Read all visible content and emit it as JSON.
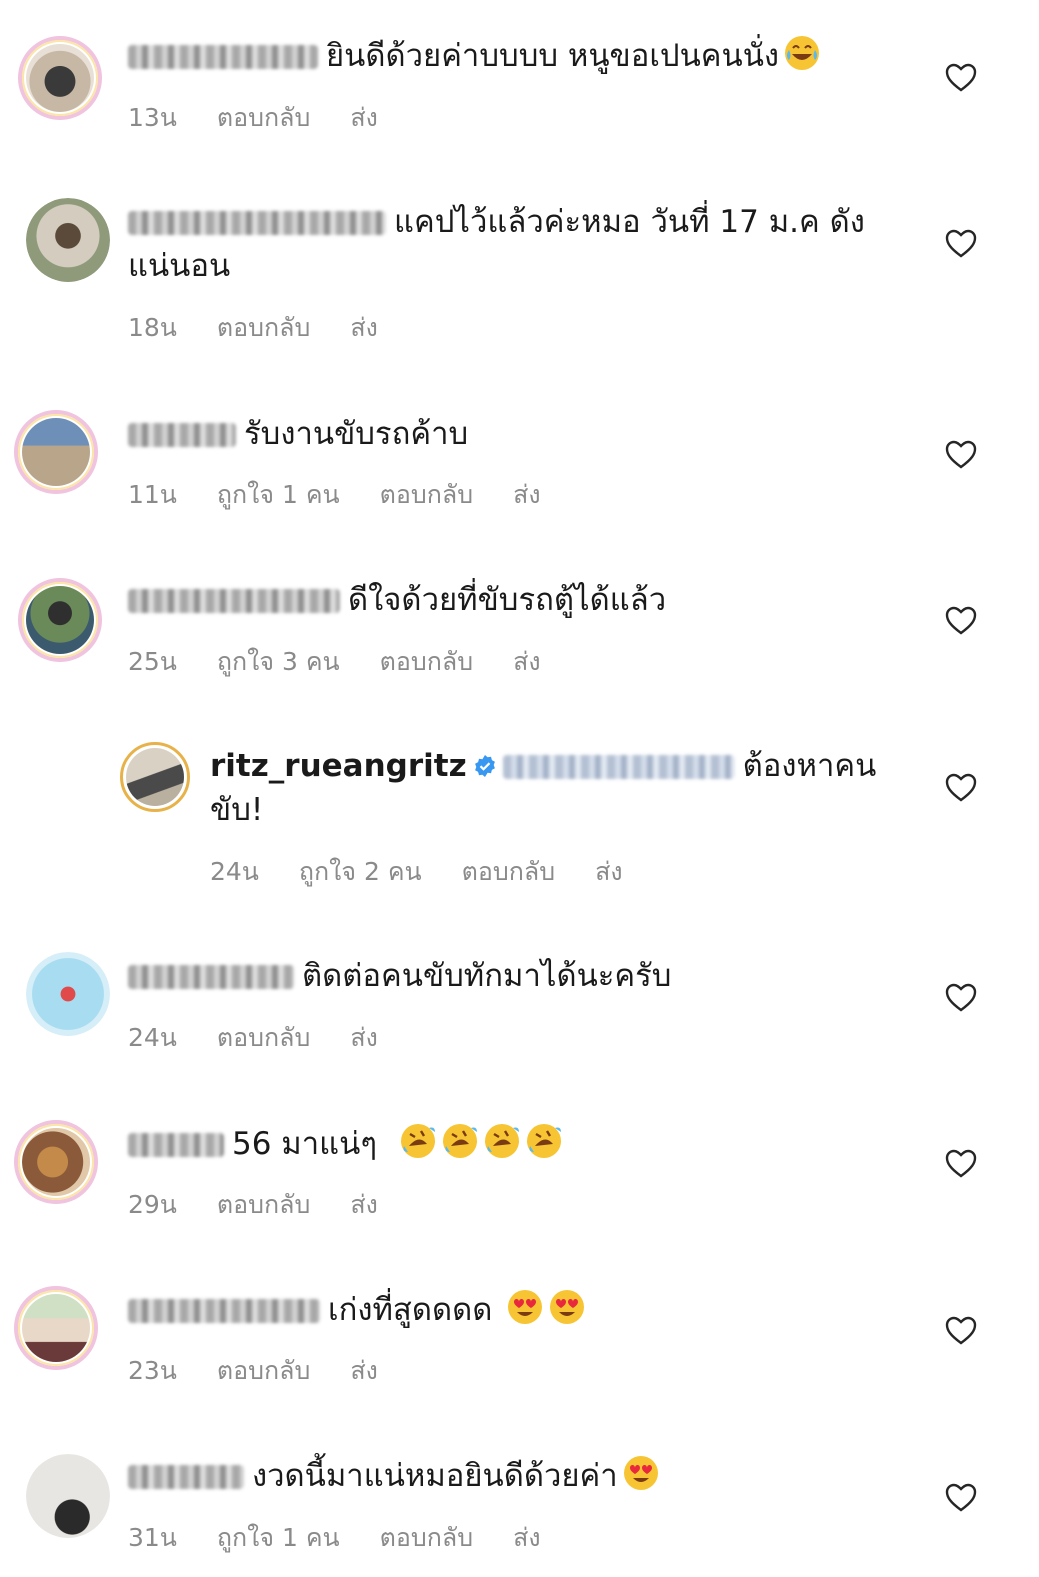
{
  "comments": [
    {
      "text": "ยินดีด้วยค่าบบบบ หนูขอเปนคนนั่ง",
      "emoji": [
        "laugh-tears"
      ],
      "time": "13น",
      "likes": "",
      "reply": "ตอบกลับ",
      "send": "ส่ง"
    },
    {
      "text": "แคปไว้แล้วค่ะหมอ วันที่ 17 ม.ค ดัง",
      "text2": "แน่นอน",
      "time": "18น",
      "likes": "",
      "reply": "ตอบกลับ",
      "send": "ส่ง"
    },
    {
      "text": "รับงานขับรถค้าบ",
      "time": "11น",
      "likes": "ถูกใจ 1 คน",
      "reply": "ตอบกลับ",
      "send": "ส่ง"
    },
    {
      "text": "ดีใจด้วยที่ขับรถตู้ได้แล้ว",
      "time": "25น",
      "likes": "ถูกใจ 3 คน",
      "reply": "ตอบกลับ",
      "send": "ส่ง"
    },
    {
      "username": "ritz_rueangritz",
      "text": "ต้องหาคน",
      "text2": "ขับ!",
      "time": "24น",
      "likes": "ถูกใจ 2 คน",
      "reply": "ตอบกลับ",
      "send": "ส่ง"
    },
    {
      "text": "ติดต่อคนขับทักมาได้นะครับ",
      "time": "24น",
      "likes": "",
      "reply": "ตอบกลับ",
      "send": "ส่ง"
    },
    {
      "text": "56 มาแน่ๆ",
      "emoji": [
        "rofl",
        "rofl",
        "rofl",
        "rofl"
      ],
      "time": "29น",
      "likes": "",
      "reply": "ตอบกลับ",
      "send": "ส่ง"
    },
    {
      "text": "เก่งที่สูดดดด",
      "emoji": [
        "heart-eyes",
        "heart-eyes"
      ],
      "time": "23น",
      "likes": "",
      "reply": "ตอบกลับ",
      "send": "ส่ง"
    },
    {
      "text": "งวดนี้มาแน่หมอยินดีด้วยค่า",
      "emoji": [
        "heart-eyes"
      ],
      "time": "31น",
      "likes": "ถูกใจ 1 คน",
      "reply": "ตอบกลับ",
      "send": "ส่ง"
    }
  ],
  "colors": {
    "accent_verified": "#3897f0",
    "meta_gray": "#8a8a8a",
    "heart_stroke": "#262626"
  }
}
